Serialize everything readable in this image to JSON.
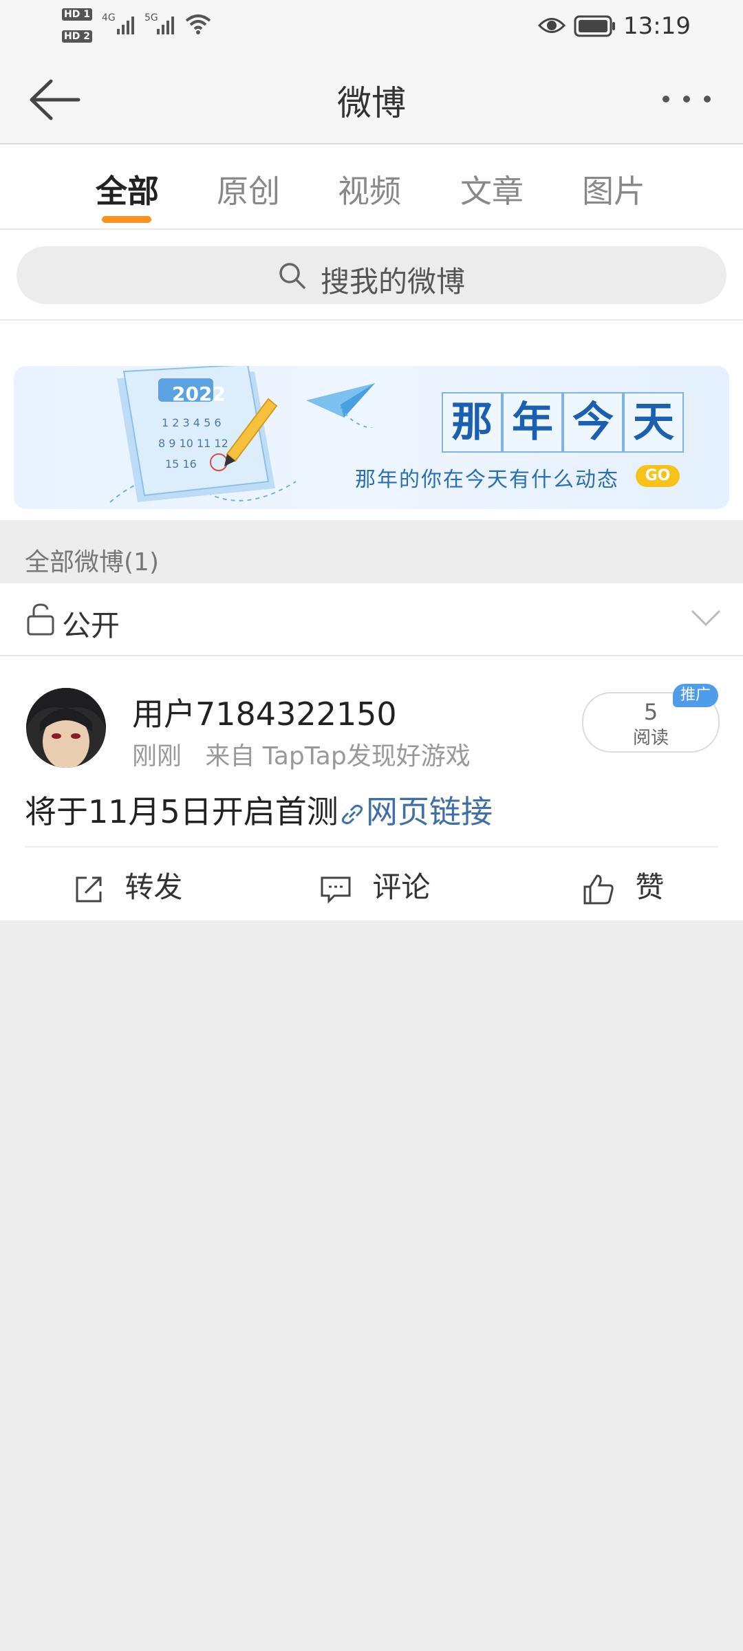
{
  "status_bar": {
    "sim1": "HD 1",
    "sim2": "HD 2",
    "net1": "4G",
    "net2": "5G",
    "time": "13:19"
  },
  "header": {
    "title": "微博"
  },
  "tabs": [
    "全部",
    "原创",
    "视频",
    "文章",
    "图片"
  ],
  "active_tab": "全部",
  "search": {
    "placeholder": "搜我的微博"
  },
  "banner": {
    "year": "2022",
    "title_chars": [
      "那",
      "年",
      "今",
      "天"
    ],
    "subtitle": "那年的你在今天有什么动态",
    "cta": "GO"
  },
  "section": {
    "label": "全部微博(1)"
  },
  "visibility": {
    "label": "公开"
  },
  "post": {
    "username": "用户7184322150",
    "time": "刚刚",
    "source": "来自 TapTap发现好游戏",
    "read_count": "5",
    "read_label": "阅读",
    "promo_badge": "推广",
    "text": "将于11月5日开启首测",
    "link_text": "网页链接",
    "actions": {
      "repost": "转发",
      "comment": "评论",
      "like": "赞"
    }
  },
  "colors": {
    "accent": "#f7931e",
    "link": "#3f6fa8",
    "banner_blue": "#1b5fb0"
  }
}
